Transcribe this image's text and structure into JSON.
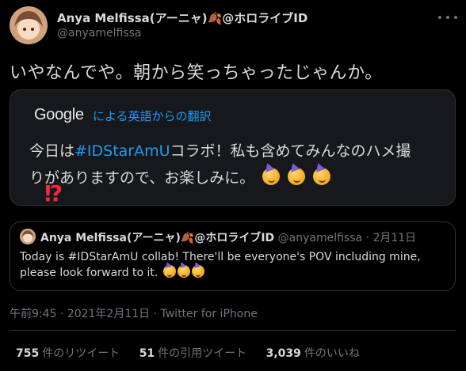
{
  "author": {
    "display_name": "Anya Melfissa(アーニャ)🍂@ホロライブID",
    "handle": "@anyamelfissa"
  },
  "tweet": {
    "text": "いやなんでや。朝から笑っちゃったじゃんか。"
  },
  "translation": {
    "brand": "Google",
    "label": "による英語からの翻訳",
    "line1_prefix": "今日は",
    "line1_hashtag": "#IDStarAmU",
    "line1_suffix": "コラボ！私も含めてみんなのハメ撮",
    "line2": "りがありますので、お楽しみに。"
  },
  "decoration": {
    "interrobang": "⁉"
  },
  "quoted": {
    "display_name": "Anya Melfissa(アーニャ)🍂@ホロライブID",
    "handle": "@anyamelfissa",
    "separator": "·",
    "date": "2月11日",
    "text": "Today is #IDStarAmU collab! There'll be everyone's POV including mine, please look forward to it."
  },
  "meta": {
    "timestamp": "午前9:45 · 2021年2月11日 · Twitter for iPhone"
  },
  "stats": {
    "retweets_count": "755",
    "retweets_label": "件のリツイート",
    "quotes_count": "51",
    "quotes_label": "件の引用ツイート",
    "likes_count": "3,039",
    "likes_label": "件のいいね"
  },
  "colors": {
    "background": "#000000",
    "accent": "#1d9bf0",
    "muted": "#6e767d",
    "interrobang": "#f0283c"
  }
}
